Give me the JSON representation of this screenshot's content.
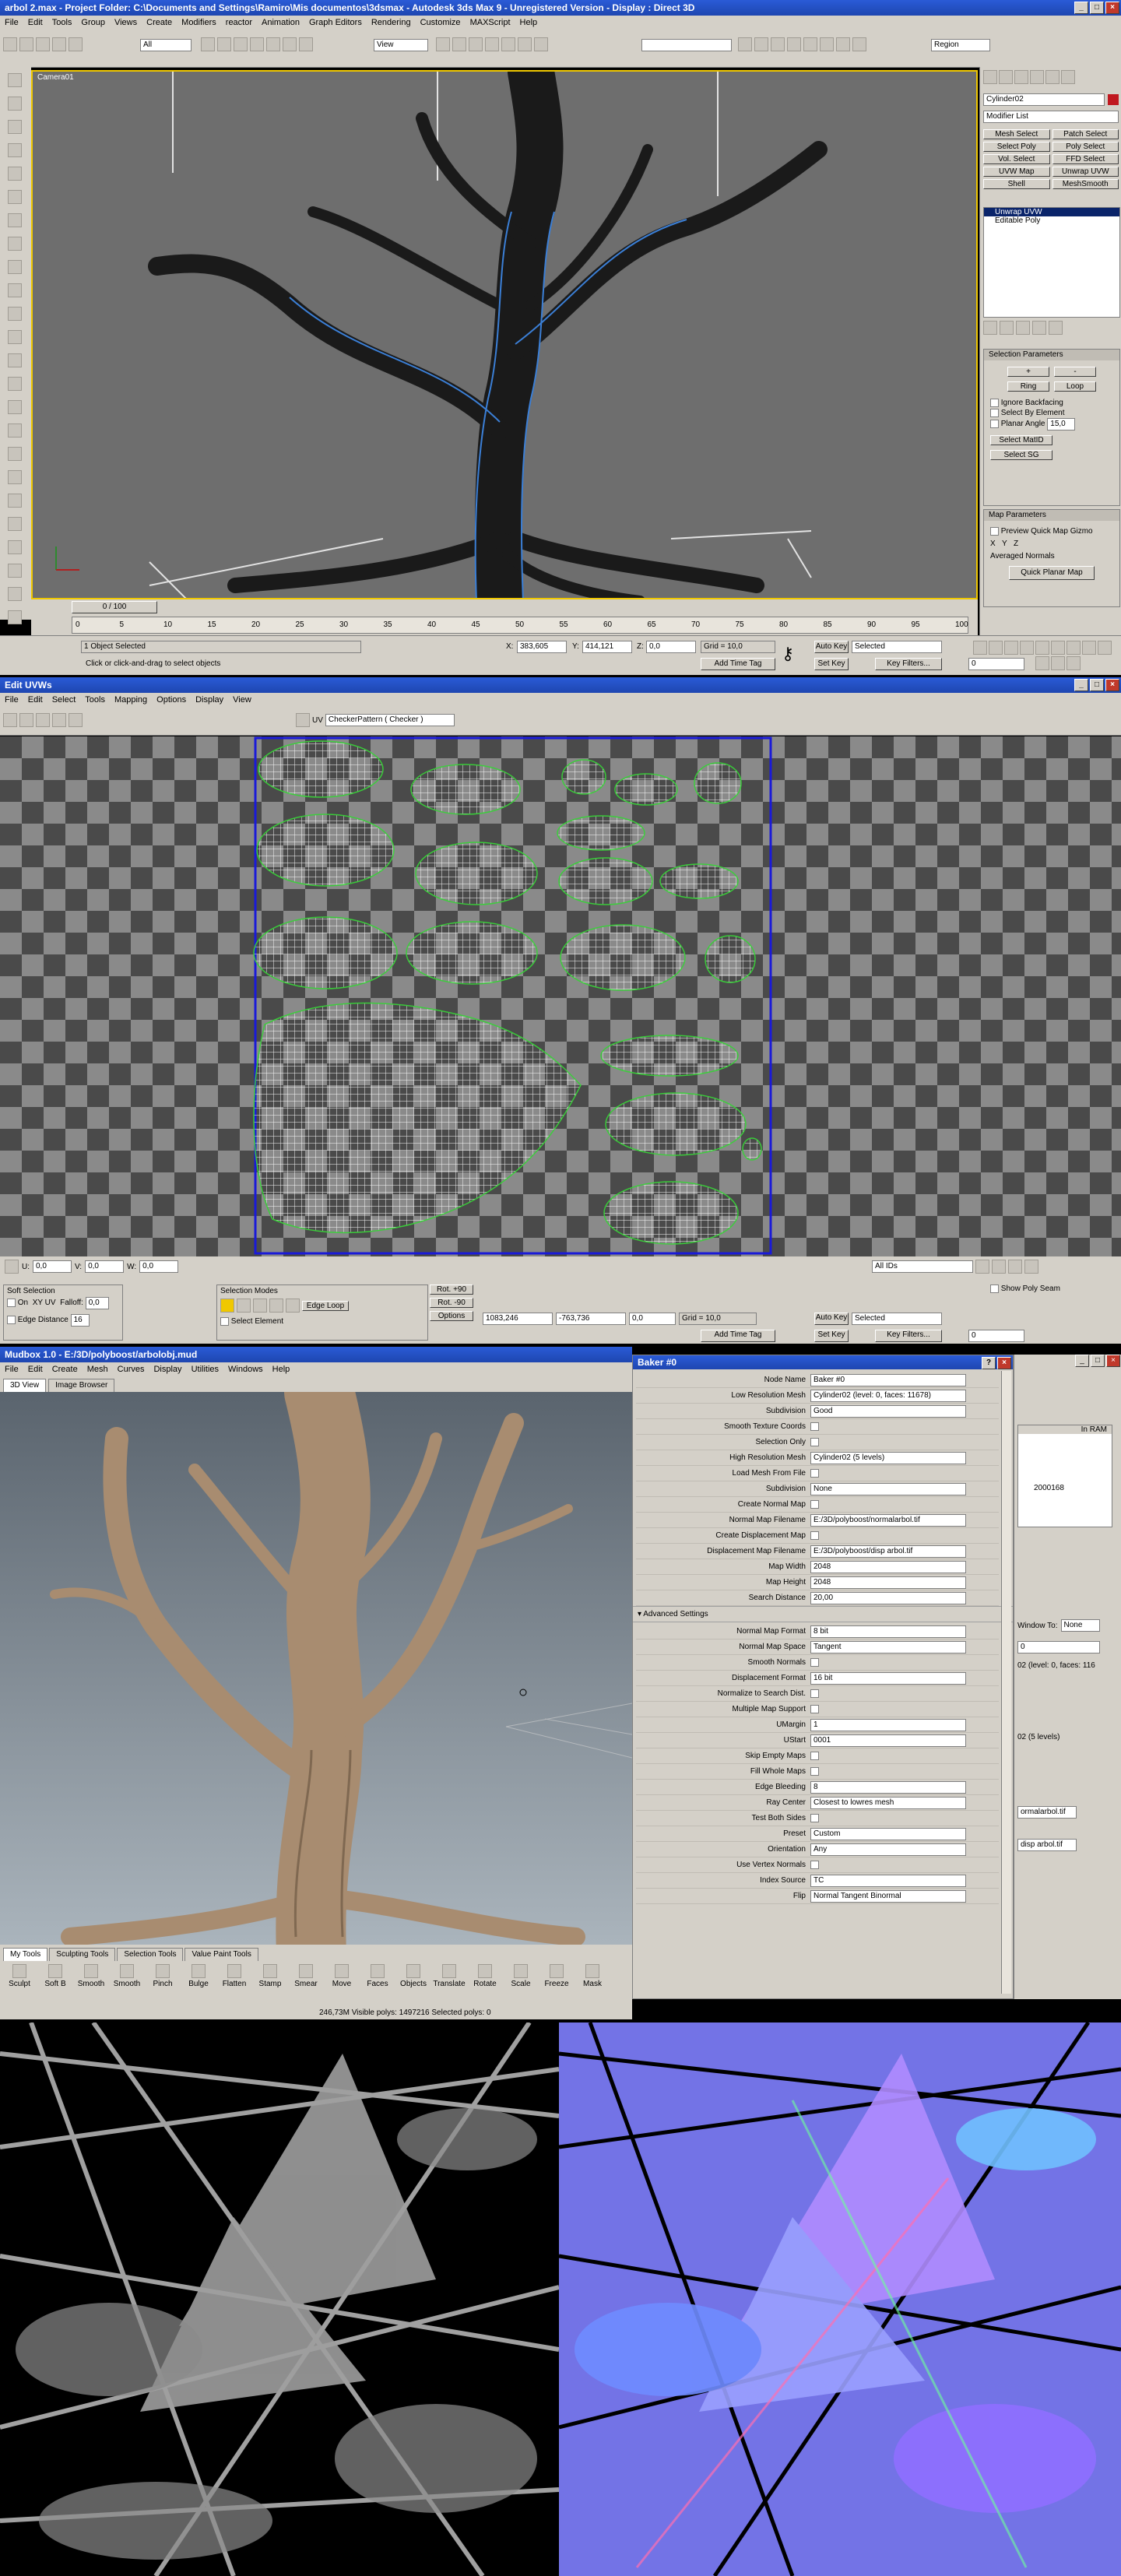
{
  "max_window": {
    "title": "arbol 2.max    - Project Folder: C:\\Documents and Settings\\Ramiro\\Mis documentos\\3dsmax      - Autodesk 3ds Max 9  - Unregistered Version      - Display : Direct 3D",
    "menu": [
      "File",
      "Edit",
      "Tools",
      "Group",
      "Views",
      "Create",
      "Modifiers",
      "reactor",
      "Animation",
      "Graph Editors",
      "Rendering",
      "Customize",
      "MAXScript",
      "Help"
    ],
    "toolbar": {
      "selection_filter": "All",
      "ref_coord": "View",
      "region": "Region"
    },
    "viewport_label": "Camera01",
    "time_slider": "0 / 100",
    "ticks": [
      "0",
      "5",
      "10",
      "15",
      "20",
      "25",
      "30",
      "35",
      "40",
      "45",
      "50",
      "55",
      "60",
      "65",
      "70",
      "75",
      "80",
      "85",
      "90",
      "95",
      "100"
    ],
    "status": {
      "selected": "1 Object Selected",
      "prompt": "Click or click-and-drag to select objects",
      "x_label": "X:",
      "x": "383,605",
      "y_label": "Y:",
      "y": "414,121",
      "z_label": "Z:",
      "z": "0,0",
      "grid": "Grid = 10,0",
      "add_time_tag": "Add Time Tag",
      "auto_key": "Auto Key",
      "set_key": "Set Key",
      "selected_dropdown": "Selected",
      "key_filters": "Key Filters...",
      "frame": "0"
    },
    "command_panel": {
      "object_name": "Cylinder02",
      "modifier_list": "Modifier List",
      "buttons": [
        "Mesh Select",
        "Patch Select",
        "Select Poly",
        "Poly Select",
        "Vol. Select",
        "FFD Select",
        "UVW Map",
        "Unwrap UVW",
        "Shell",
        "MeshSmooth"
      ],
      "stack": [
        "Unwrap UVW",
        "Editable Poly"
      ],
      "selection_params_title": "Selection Parameters",
      "sel_buttons": [
        "+",
        "-",
        "Ring",
        "Loop"
      ],
      "sel_checks": [
        "Ignore Backfacing",
        "Select By Element",
        "Planar Angle"
      ],
      "planar_angle": "15,0",
      "select_matid": "Select MatID",
      "select_sg": "Select SG",
      "map_params_title": "Map Parameters",
      "preview_quick": "Preview Quick Map Gizmo",
      "axes": [
        "X",
        "Y",
        "Z"
      ],
      "averaged_normals": "Averaged Normals",
      "quick_planar": "Quick Planar Map"
    }
  },
  "uvw_window": {
    "title": "Edit UVWs",
    "menu": [
      "File",
      "Edit",
      "Select",
      "Tools",
      "Mapping",
      "Options",
      "Display",
      "View"
    ],
    "uv_label": "UV",
    "checker_dropdown": "CheckerPattern  ( Checker )",
    "u_label": "U:",
    "u_value": "0,0",
    "v_label": "V:",
    "v_value": "0,0",
    "w_label": "W:",
    "w_value": "0,0",
    "all_ids": "All IDs",
    "soft_selection": "Soft Selection",
    "on": "On",
    "xy": "XY",
    "uv": "UV",
    "falloff": "Falloff:",
    "falloff_value": "0,0",
    "edge_distance": "Edge Distance",
    "edge_distance_value": "16",
    "selection_modes": "Selection Modes",
    "edge_loop": "Edge Loop",
    "select_element": "Select Element",
    "rot_plus": "Rot. +90",
    "rot_minus": "Rot. -90",
    "options": "Options",
    "show_seam": "Show Poly Seam",
    "x": "1083,246",
    "y": "-763,736",
    "z": "0,0",
    "grid": "Grid = 10,0",
    "add_time_tag": "Add Time Tag",
    "auto_key": "Auto Key",
    "set_key": "Set Key",
    "selected": "Selected",
    "key_filters": "Key Filters...",
    "frame": "0"
  },
  "mudbox": {
    "title": "Mudbox 1.0  -  E:/3D/polyboost/arbolobj.mud",
    "menu": [
      "File",
      "Edit",
      "Create",
      "Mesh",
      "Curves",
      "Display",
      "Utilities",
      "Windows",
      "Help"
    ],
    "tabs": [
      "3D View",
      "Image Browser"
    ],
    "tool_tabs": [
      "My Tools",
      "Sculpting Tools",
      "Selection Tools",
      "Value Paint Tools"
    ],
    "tools": [
      "Sculpt",
      "Soft B",
      "Smooth",
      "Smooth",
      "Pinch",
      "Bulge",
      "Flatten",
      "Stamp",
      "Smear",
      "Move",
      "Faces",
      "Objects",
      "Translate",
      "Rotate",
      "Scale",
      "Freeze",
      "Mask"
    ],
    "status": "246,73M  Visible polys: 1497216  Selected polys: 0"
  },
  "baker": {
    "title": "Baker #0",
    "rows": [
      {
        "label": "Node Name",
        "value": "Baker #0"
      },
      {
        "label": "Low Resolution Mesh",
        "value": "Cylinder02 (level: 0, faces: 11678)"
      },
      {
        "label": "Subdivision",
        "value": "Good"
      },
      {
        "label": "Smooth Texture Coords",
        "value": ""
      },
      {
        "label": "Selection Only",
        "value": ""
      },
      {
        "label": "High Resolution Mesh",
        "value": "Cylinder02 (5 levels)"
      },
      {
        "label": "Load Mesh From File",
        "value": ""
      },
      {
        "label": "Subdivision",
        "value": "None"
      },
      {
        "label": "Create Normal Map",
        "value": ""
      },
      {
        "label": "Normal Map Filename",
        "value": "E:/3D/polyboost/normalarbol.tif"
      },
      {
        "label": "Create Displacement Map",
        "value": ""
      },
      {
        "label": "Displacement Map Filename",
        "value": "E:/3D/polyboost/disp arbol.tif"
      },
      {
        "label": "Map Width",
        "value": "2048"
      },
      {
        "label": "Map Height",
        "value": "2048"
      },
      {
        "label": "Search Distance",
        "value": "20,00"
      }
    ],
    "advanced_title": "Advanced Settings",
    "advanced_rows": [
      {
        "label": "Normal Map Format",
        "value": "8 bit"
      },
      {
        "label": "Normal Map Space",
        "value": "Tangent"
      },
      {
        "label": "Smooth Normals",
        "value": ""
      },
      {
        "label": "Displacement Format",
        "value": "16 bit"
      },
      {
        "label": "Normalize to Search Dist.",
        "value": ""
      },
      {
        "label": "Multiple Map Support",
        "value": ""
      },
      {
        "label": "UMargin",
        "value": "1"
      },
      {
        "label": "UStart",
        "value": "0001"
      },
      {
        "label": "Skip Empty Maps",
        "value": ""
      },
      {
        "label": "Fill Whole Maps",
        "value": ""
      },
      {
        "label": "Edge Bleeding",
        "value": "8"
      },
      {
        "label": "Ray Center",
        "value": "Closest to lowres mesh"
      },
      {
        "label": "Test Both Sides",
        "value": ""
      },
      {
        "label": "Preset",
        "value": "Custom"
      },
      {
        "label": "Orientation",
        "value": "Any"
      },
      {
        "label": "Use Vertex Normals",
        "value": ""
      },
      {
        "label": "Index Source",
        "value": "TC"
      },
      {
        "label": "Flip",
        "value": "Normal   Tangent   Binormal"
      }
    ],
    "side": {
      "in_ram": "In RAM",
      "value": "2000168",
      "window_to": "Window To:",
      "none": "None",
      "zero": "0",
      "level_text": "02 (level: 0, faces: 116",
      "levels5": "02 (5 levels)",
      "normal_file": "ormalarbol.tif",
      "disp_file": "disp arbol.tif"
    }
  },
  "colors": {
    "uv_grid": "#ffffff",
    "uv_seams": "#39d139",
    "uv_border": "#1a1ad8",
    "normal_map": "#7f7fff"
  }
}
